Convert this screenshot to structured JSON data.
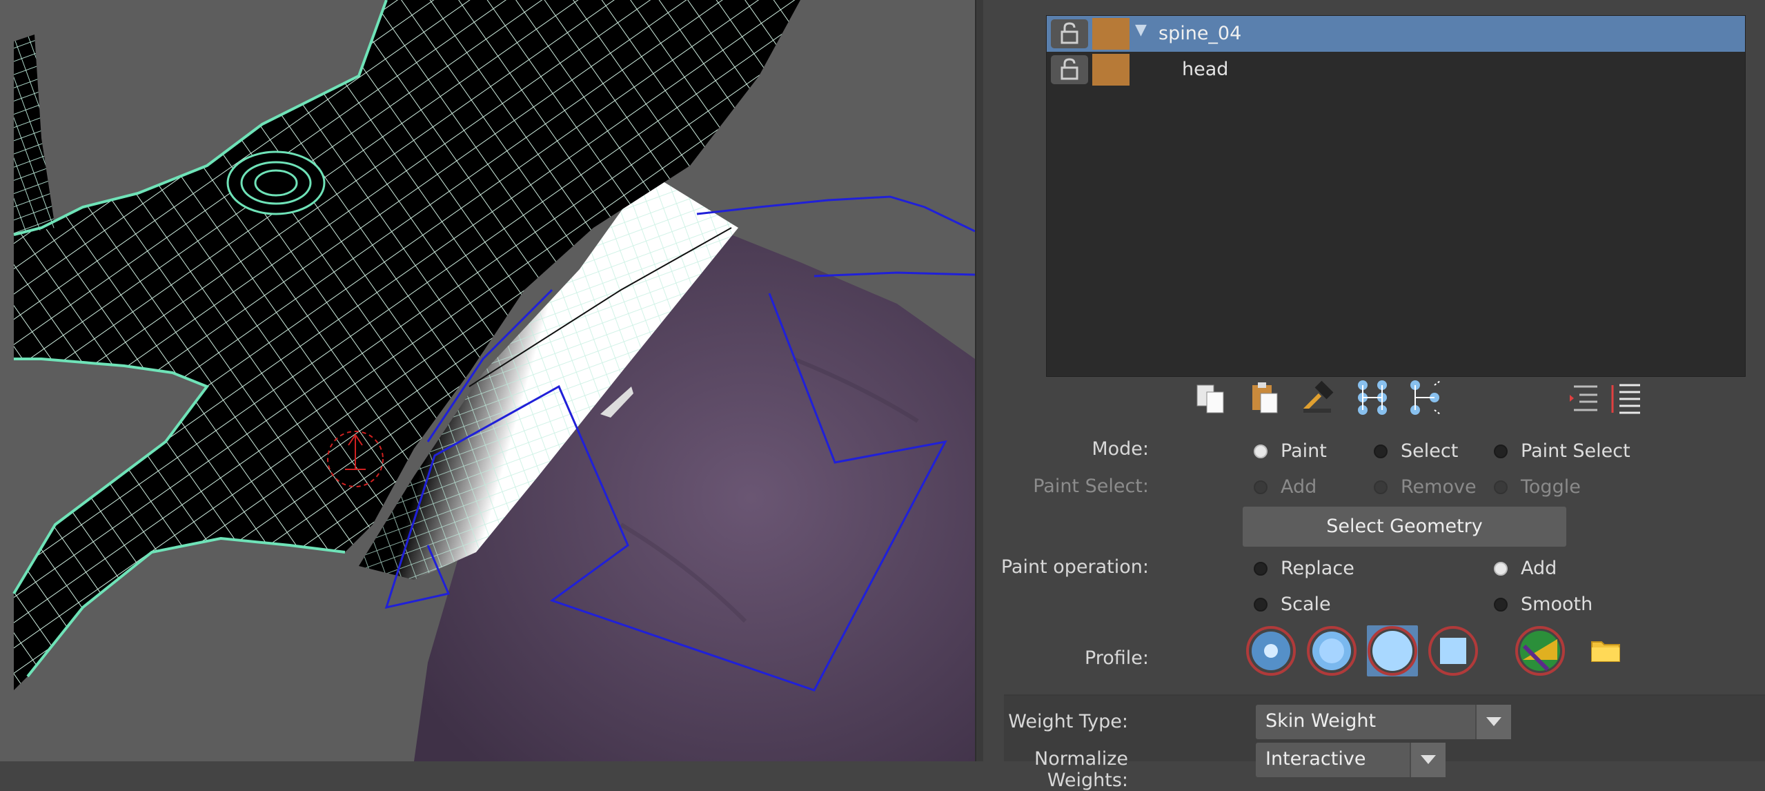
{
  "outliner": {
    "rows": [
      {
        "label": "spine_04",
        "selected": true,
        "expanded": true
      },
      {
        "label": "head",
        "selected": false
      }
    ]
  },
  "toolbar_icons": [
    "copy-weights-icon",
    "paste-weights-icon",
    "hammer-weights-icon",
    "move-weights-icon",
    "show-influences-icon",
    "collapse-all-icon",
    "expand-all-icon"
  ],
  "mode": {
    "label": "Mode:",
    "options": [
      "Paint",
      "Select",
      "Paint Select"
    ],
    "selected": "Paint"
  },
  "paint_select": {
    "label": "Paint Select:",
    "options": [
      "Add",
      "Remove",
      "Toggle"
    ],
    "enabled": false
  },
  "select_geometry_label": "Select Geometry",
  "paint_operation": {
    "label": "Paint operation:",
    "options": [
      "Replace",
      "Add",
      "Scale",
      "Smooth"
    ],
    "selected": "Add"
  },
  "profile": {
    "label": "Profile:",
    "options": [
      "gaussian-brush-icon",
      "soft-brush-icon",
      "solid-brush-icon",
      "square-brush-icon",
      "image-brush-icon",
      "folder-icon"
    ],
    "selected": "solid-brush-icon"
  },
  "weight_type": {
    "label": "Weight Type:",
    "value": "Skin Weight"
  },
  "normalize_weights": {
    "label": "Normalize Weights:",
    "value": "Interactive"
  },
  "colors": {
    "selection_blue": "#5a80ae",
    "swatch_orange": "#b77a37",
    "wire_green": "#6fe3b8",
    "joint_blue": "#2020d8",
    "mesh_purple": "#56435f"
  }
}
